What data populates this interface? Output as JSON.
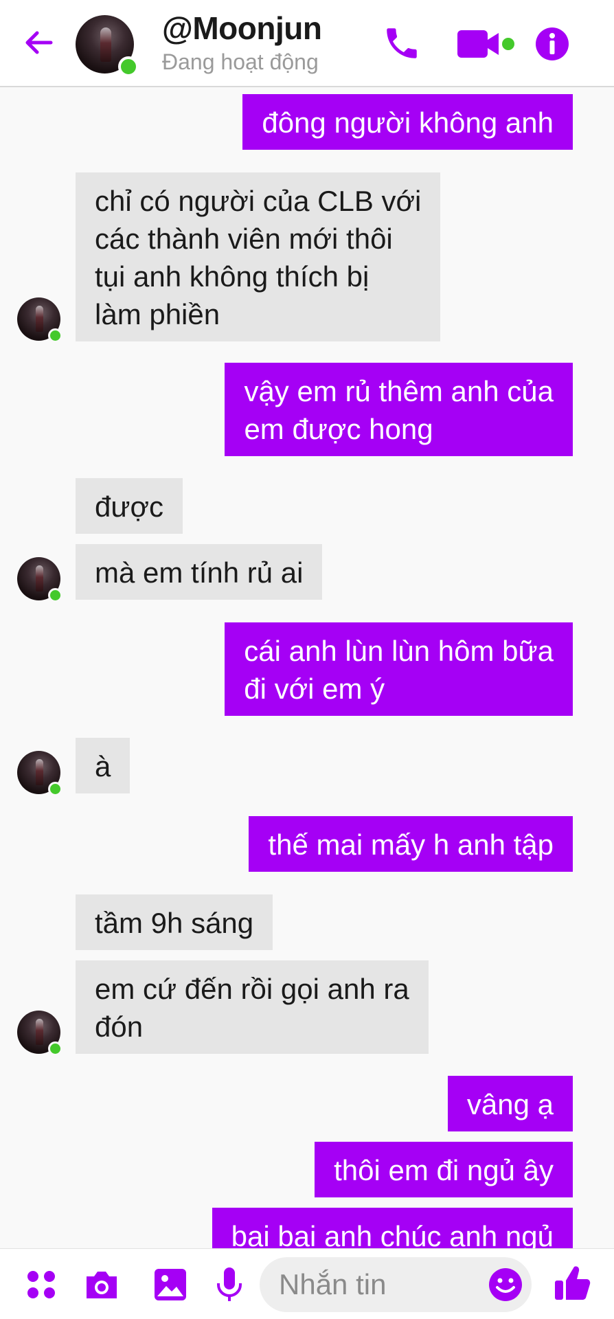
{
  "header": {
    "contact_name": "@Moonjun",
    "status": "Đang hoạt động",
    "icons": [
      "back-arrow-icon",
      "phone-icon",
      "video-camera-icon",
      "info-icon"
    ]
  },
  "messages": [
    {
      "side": "out",
      "text": [
        "đông người không anh"
      ]
    },
    {
      "side": "in",
      "text": [
        "chỉ có người của CLB với",
        "các thành viên mới thôi",
        "tụi anh không thích bị",
        "làm phiền"
      ]
    },
    {
      "side": "out",
      "text": [
        "vậy em rủ thêm anh của",
        "em được hong"
      ]
    },
    {
      "side": "in",
      "text": [
        "được"
      ]
    },
    {
      "side": "in",
      "text": [
        "mà em tính rủ ai"
      ]
    },
    {
      "side": "out",
      "text": [
        "cái anh lùn lùn hôm bữa",
        "đi với em ý"
      ]
    },
    {
      "side": "in",
      "text": [
        "à"
      ]
    },
    {
      "side": "out",
      "text": [
        "thế mai mấy h anh tập"
      ]
    },
    {
      "side": "in",
      "text": [
        "tầm 9h sáng"
      ]
    },
    {
      "side": "in",
      "text": [
        "em cứ đến rồi gọi anh ra",
        "đón"
      ]
    },
    {
      "side": "out",
      "text": [
        "vâng ạ"
      ]
    },
    {
      "side": "out",
      "text": [
        "thôi em đi ngủ ây"
      ]
    },
    {
      "side": "out",
      "text": [
        "bai bai anh chúc anh ngủ"
      ]
    }
  ],
  "composer": {
    "placeholder": "Nhắn tin",
    "icons": [
      "apps-icon",
      "camera-icon",
      "gallery-icon",
      "microphone-icon",
      "emoji-icon",
      "thumbs-up-icon"
    ]
  },
  "colors": {
    "accent": "#a500f5",
    "incoming_bubble": "#e5e5e5",
    "online": "#44c92b",
    "background": "#f9f9f9"
  }
}
